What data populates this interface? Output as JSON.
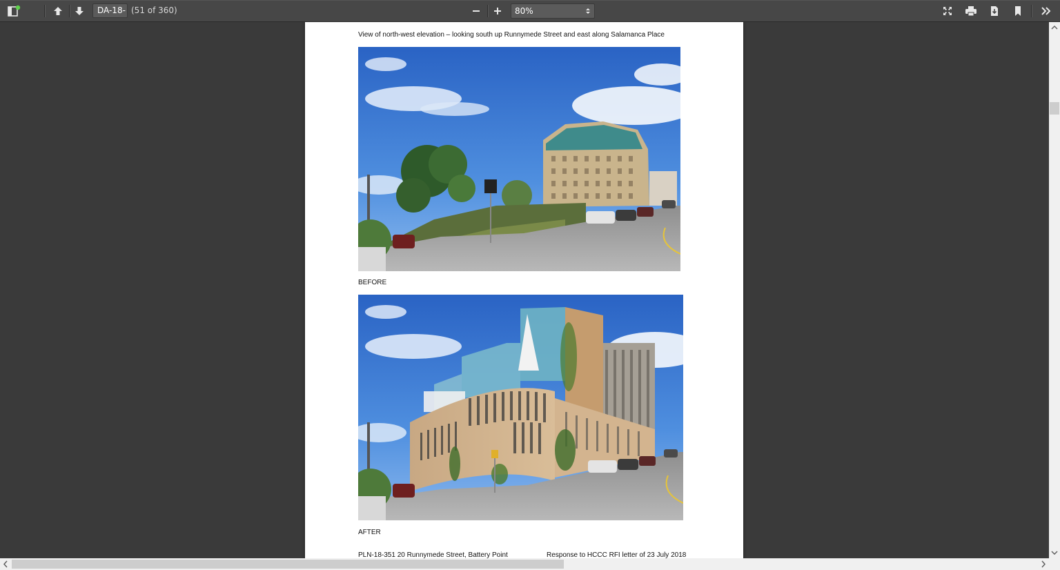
{
  "toolbar": {
    "page_input_value": "DA-18-",
    "page_count": "(51 of 360)",
    "zoom_value": "80%",
    "icons": [
      "sidebar-toggle-icon",
      "previous-page-icon",
      "next-page-icon",
      "zoom-out-icon",
      "zoom-in-icon",
      "presentation-mode-icon",
      "print-icon",
      "download-icon",
      "bookmark-icon",
      "tools-icon"
    ]
  },
  "document": {
    "heading": "View of north-west elevation – looking south up Runnymede Street and east along Salamanca Place",
    "before_label": "BEFORE",
    "after_label": "AFTER",
    "footer_left": "PLN-18-351 20 Runnymede Street, Battery Point",
    "footer_right": "Response to HCCC RFI letter of 23 July 2018"
  },
  "colors": {
    "toolbar_bg": "#474747",
    "viewer_bg": "#3a3a3a",
    "page_bg": "#ffffff",
    "notification_dot": "#5fd14c"
  }
}
